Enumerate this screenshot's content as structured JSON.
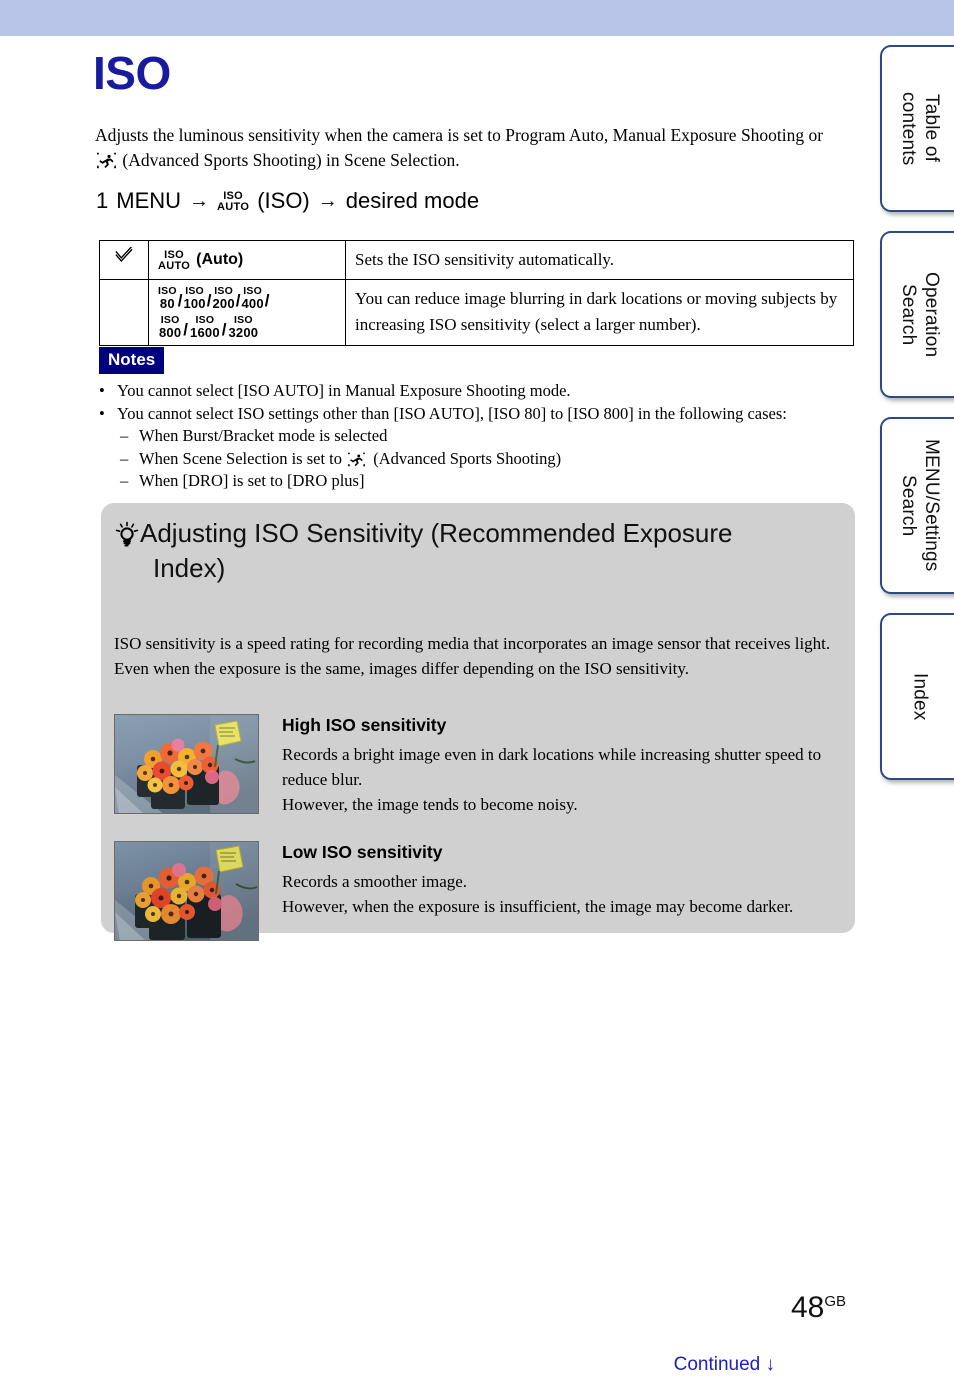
{
  "document": {
    "title": "ISO",
    "intro_before_icon": "Adjusts the luminous sensitivity when the camera is set to Program Auto, Manual Exposure Shooting or ",
    "intro_after_icon": " (Advanced Sports Shooting) in Scene Selection."
  },
  "step": {
    "number": "1",
    "menu_label": "MENU",
    "arrow_1": "→",
    "icon_line_1": "ISO",
    "icon_line_2": "AUTO",
    "iso_label": "(ISO)",
    "arrow_2": "→",
    "target": "desired mode"
  },
  "table": {
    "rows": [
      {
        "checked": true,
        "check_glyph": "✓",
        "option_icon_line_1": "ISO",
        "option_icon_line_2": "AUTO",
        "option_label": "(Auto)",
        "description": "Sets the ISO sensitivity automatically."
      },
      {
        "checked": false,
        "iso_values_row_1": [
          "80",
          "100",
          "200",
          "400"
        ],
        "iso_values_row_2": [
          "800",
          "1600",
          "3200"
        ],
        "iso_prefix": "ISO",
        "separator": "/",
        "description": "You can reduce image blurring in dark locations or moving subjects by increasing ISO sensitivity (select a larger number)."
      }
    ]
  },
  "notes": {
    "badge": "Notes",
    "bullet": "•",
    "dash": "–",
    "items": [
      {
        "text": "You cannot select [ISO AUTO] in Manual Exposure Shooting mode.",
        "sub_items": []
      },
      {
        "text": "You cannot select ISO settings other than [ISO AUTO], [ISO 80] to [ISO 800] in the following cases:",
        "sub_items": [
          {
            "text": "When Burst/Bracket mode is selected",
            "has_icon": false
          },
          {
            "text_before_icon": "When Scene Selection is set to ",
            "text_after_icon": " (Advanced Sports Shooting)",
            "has_icon": true
          },
          {
            "text": "When [DRO] is set to [DRO plus]",
            "has_icon": false
          }
        ]
      }
    ]
  },
  "tip_box": {
    "heading_line_1": "Adjusting ISO Sensitivity (Recommended Exposure",
    "heading_line_2": "Index)",
    "paragraph": "ISO sensitivity is a speed rating for recording media that incorporates an image sensor that receives light. Even when the exposure is the same, images differ depending on the ISO sensitivity.",
    "entries": [
      {
        "subtitle": "High ISO sensitivity",
        "body_line_1": "Records a bright image even in dark locations while increasing shutter speed to reduce blur.",
        "body_line_2": "However, the image tends to become noisy.",
        "photo_alt": "flowers-photo-high-iso"
      },
      {
        "subtitle": "Low ISO sensitivity",
        "body_line_1": "Records a smoother image.",
        "body_line_2": "However, when the exposure is insufficient, the image may become darker.",
        "photo_alt": "flowers-photo-low-iso"
      }
    ]
  },
  "side_tabs": [
    {
      "label": "Table of\ncontents"
    },
    {
      "label": "Operation\nSearch"
    },
    {
      "label": "MENU/Settings\nSearch"
    },
    {
      "label": "Index"
    }
  ],
  "footer": {
    "page_number": "48",
    "page_suffix": "GB",
    "continued": "Continued",
    "continued_arrow": "↓"
  },
  "colors": {
    "top_band": "#b9c5e8",
    "title": "#1a1a9e",
    "notes_badge_bg": "#00007e",
    "tip_box_bg": "#d0d0d0",
    "tab_border": "#2c4a86",
    "continued_text": "#2020c0"
  }
}
